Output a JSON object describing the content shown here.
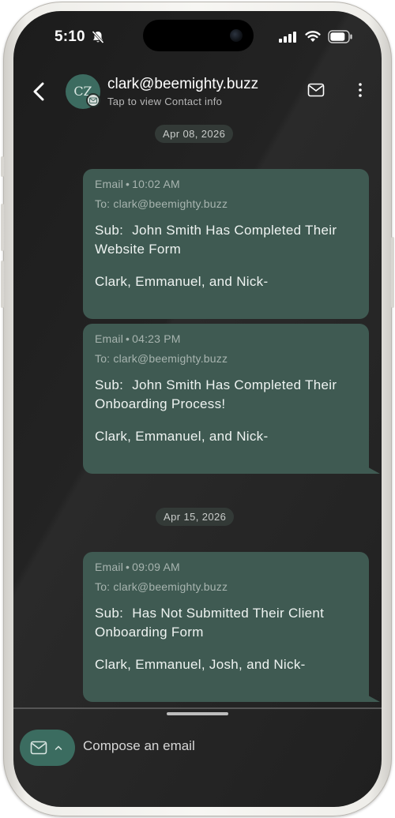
{
  "status_bar": {
    "time": "5:10"
  },
  "header": {
    "avatar_initials": "CZ",
    "contact": "clark@beemighty.buzz",
    "subtitle": "Tap to view Contact info"
  },
  "dates": [
    "Apr 08, 2026",
    "Apr 15, 2026"
  ],
  "messages": [
    {
      "channel": "Email",
      "time": "10:02 AM",
      "to": "To: clark@beemighty.buzz",
      "sub_label": "Sub:",
      "subject_line1": "John Smith Has Completed Their",
      "subject_line2": "Website Form",
      "signature": "Clark, Emmanuel, and Nick-"
    },
    {
      "channel": "Email",
      "time": "04:23 PM",
      "to": "To: clark@beemighty.buzz",
      "sub_label": "Sub:",
      "subject_line1": "John Smith Has Completed Their",
      "subject_line2": "Onboarding Process!",
      "signature": "Clark, Emmanuel, and Nick-"
    },
    {
      "channel": "Email",
      "time": "09:09 AM",
      "to": "To: clark@beemighty.buzz",
      "sub_label": "Sub:",
      "subject_line1": "Has Not Submitted Their Client",
      "subject_line2": "Onboarding Form",
      "signature": "Clark, Emmanuel, Josh, and Nick-"
    }
  ],
  "composer": {
    "placeholder": "Compose an email"
  },
  "colors": {
    "bubble": "#3f5a52",
    "accent": "#3b6c60",
    "background": "#1f1f1f"
  },
  "icons": [
    "bell-slash-icon",
    "signal-icon",
    "wifi-icon",
    "battery-icon",
    "back-chevron-icon",
    "mail-icon",
    "more-vertical-icon",
    "chevron-up-icon"
  ]
}
